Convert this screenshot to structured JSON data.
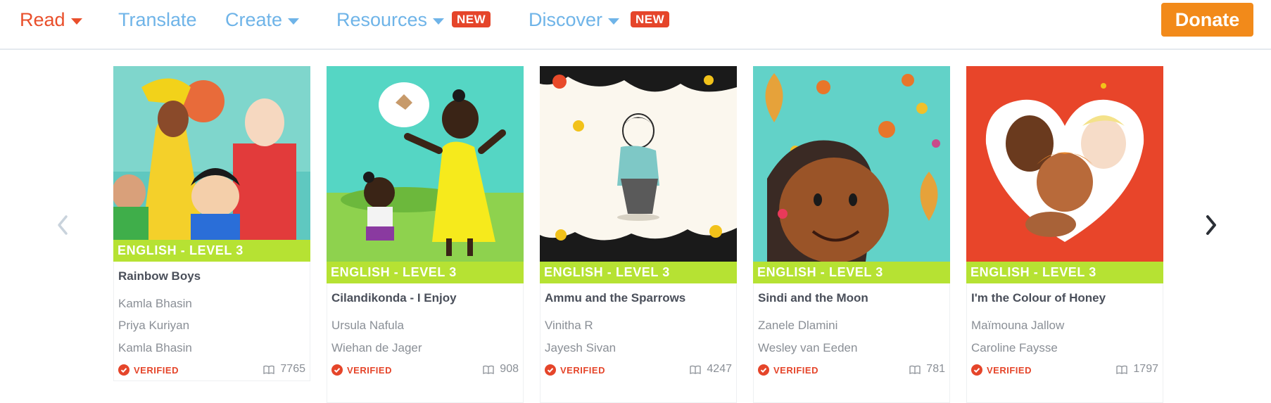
{
  "nav": {
    "read": "Read",
    "translate": "Translate",
    "create": "Create",
    "resources": "Resources",
    "discover": "Discover",
    "new_badge": "NEW",
    "donate": "Donate"
  },
  "colors": {
    "accent_red": "#e94f2b",
    "nav_blue": "#6fb4e8",
    "donate_orange": "#f28a1a",
    "level_green": "#b6e233"
  },
  "carousel": {
    "prev_icon": "chevron-left-icon",
    "next_icon": "chevron-right-icon",
    "cards": [
      {
        "level": "ENGLISH - LEVEL 3",
        "title": "Rainbow Boys",
        "people": [
          "Kamla Bhasin",
          "Priya Kuriyan",
          "Kamla Bhasin"
        ],
        "verified": "VERIFIED",
        "reads": "7765"
      },
      {
        "level": "ENGLISH - LEVEL 3",
        "title": "Cilandikonda - I Enjoy",
        "people": [
          "Ursula Nafula",
          "Wiehan de Jager"
        ],
        "verified": "VERIFIED",
        "reads": "908"
      },
      {
        "level": "ENGLISH - LEVEL 3",
        "title": "Ammu and the Sparrows",
        "people": [
          "Vinitha R",
          "Jayesh Sivan"
        ],
        "verified": "VERIFIED",
        "reads": "4247"
      },
      {
        "level": "ENGLISH - LEVEL 3",
        "title": "Sindi and the Moon",
        "people": [
          "Zanele Dlamini",
          "Wesley van Eeden"
        ],
        "verified": "VERIFIED",
        "reads": "781"
      },
      {
        "level": "ENGLISH - LEVEL 3",
        "title": "I'm the Colour of Honey",
        "people": [
          "Maïmouna Jallow",
          "Caroline Faysse"
        ],
        "verified": "VERIFIED",
        "reads": "1797"
      }
    ]
  }
}
